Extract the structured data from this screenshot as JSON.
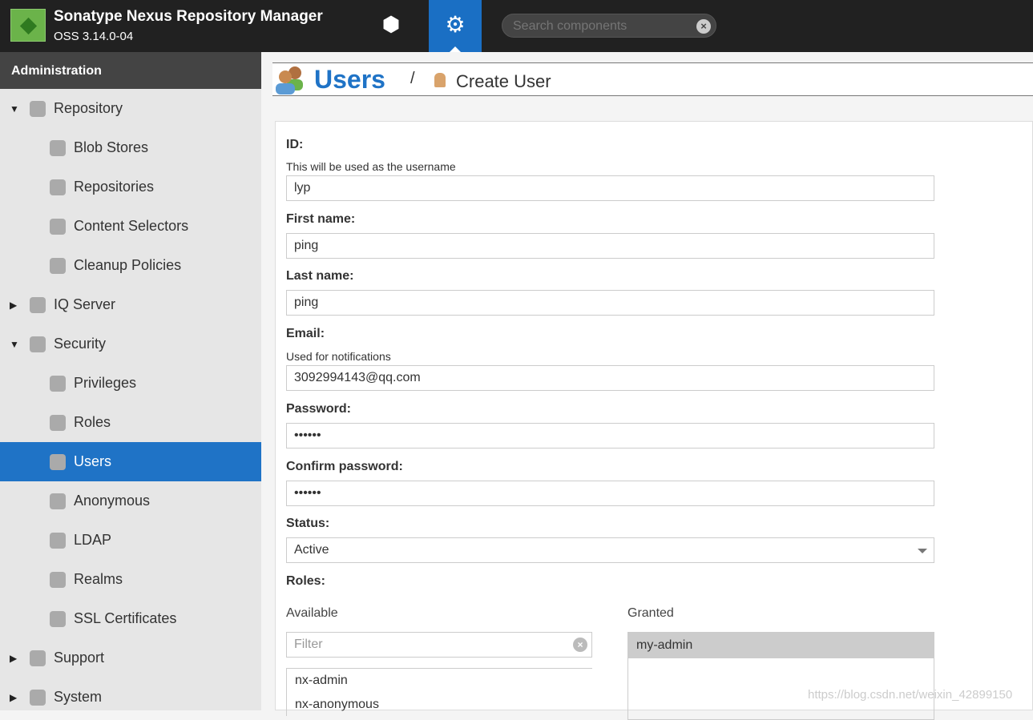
{
  "header": {
    "app_name": "Sonatype Nexus Repository Manager",
    "version": "OSS 3.14.0-04",
    "search_placeholder": "Search components"
  },
  "sidebar": {
    "title": "Administration",
    "items": [
      {
        "label": "Repository",
        "level": 0,
        "expanded": true,
        "icon": "database-icon"
      },
      {
        "label": "Blob Stores",
        "level": 1,
        "icon": "server-icon"
      },
      {
        "label": "Repositories",
        "level": 1,
        "icon": "database-icon"
      },
      {
        "label": "Content Selectors",
        "level": 1,
        "icon": "selector-icon"
      },
      {
        "label": "Cleanup Policies",
        "level": 1,
        "icon": "broom-icon"
      },
      {
        "label": "IQ Server",
        "level": 0,
        "expanded": false,
        "icon": "iq-icon"
      },
      {
        "label": "Security",
        "level": 0,
        "expanded": true,
        "icon": "security-icon"
      },
      {
        "label": "Privileges",
        "level": 1,
        "icon": "medal-icon"
      },
      {
        "label": "Roles",
        "level": 1,
        "icon": "role-icon"
      },
      {
        "label": "Users",
        "level": 1,
        "selected": true,
        "icon": "users-icon"
      },
      {
        "label": "Anonymous",
        "level": 1,
        "icon": "anonymous-icon"
      },
      {
        "label": "LDAP",
        "level": 1,
        "icon": "book-icon"
      },
      {
        "label": "Realms",
        "level": 1,
        "icon": "shield-icon"
      },
      {
        "label": "SSL Certificates",
        "level": 1,
        "icon": "certificate-icon"
      },
      {
        "label": "Support",
        "level": 0,
        "expanded": false,
        "icon": "lifebuoy-icon"
      },
      {
        "label": "System",
        "level": 0,
        "expanded": false,
        "icon": "gear-icon"
      }
    ]
  },
  "breadcrumb": {
    "title": "Users",
    "separator": "/",
    "current": "Create User"
  },
  "form": {
    "id_label": "ID:",
    "id_hint": "This will be used as the username",
    "id_value": "lyp",
    "first_label": "First name:",
    "first_value": "ping",
    "last_label": "Last name:",
    "last_value": "ping",
    "email_label": "Email:",
    "email_hint": "Used for notifications",
    "email_value": "3092994143@qq.com",
    "password_label": "Password:",
    "password_value": "••••••",
    "confirm_label": "Confirm password:",
    "confirm_value": "••••••",
    "status_label": "Status:",
    "status_value": "Active",
    "roles_label": "Roles:",
    "available_label": "Available",
    "granted_label": "Granted",
    "filter_placeholder": "Filter",
    "available": [
      "nx-admin",
      "nx-anonymous"
    ],
    "granted": [
      "my-admin"
    ]
  },
  "watermark": "https://blog.csdn.net/weixin_42899150",
  "colors": {
    "accent": "#1f73c6",
    "header": "#212121",
    "sidebar": "#e6e6e6"
  }
}
